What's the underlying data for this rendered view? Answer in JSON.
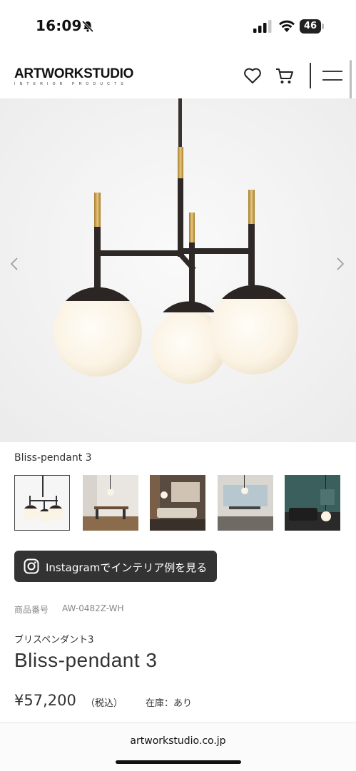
{
  "status_bar": {
    "time": "16:09",
    "battery": "46",
    "icons": [
      "bell-slash-icon",
      "cellular-signal-icon",
      "wifi-icon",
      "battery-icon"
    ]
  },
  "header": {
    "logo_main": "ARTWORKSTUDIO",
    "logo_sub": "INTERIOR PRODUCTS",
    "icons": [
      "heart-icon",
      "cart-icon",
      "hamburger-menu-icon"
    ]
  },
  "product": {
    "image_caption": "Bliss-pendant 3",
    "thumbnail_count": 5,
    "instagram_button_label": "Instagramでインテリア例を見る",
    "sku_label": "商品番号",
    "sku_value": "AW-0482Z-WH",
    "name_ja": "ブリスペンダント3",
    "name_en": "Bliss-pendant 3",
    "price": "¥57,200",
    "price_tax": "（税込）",
    "stock": "在庫：あり"
  },
  "browser": {
    "url": "artworkstudio.co.jp"
  },
  "colors": {
    "accent_dark": "#333333",
    "brass": "#c9a24a",
    "globe": "#fbf5ec"
  }
}
